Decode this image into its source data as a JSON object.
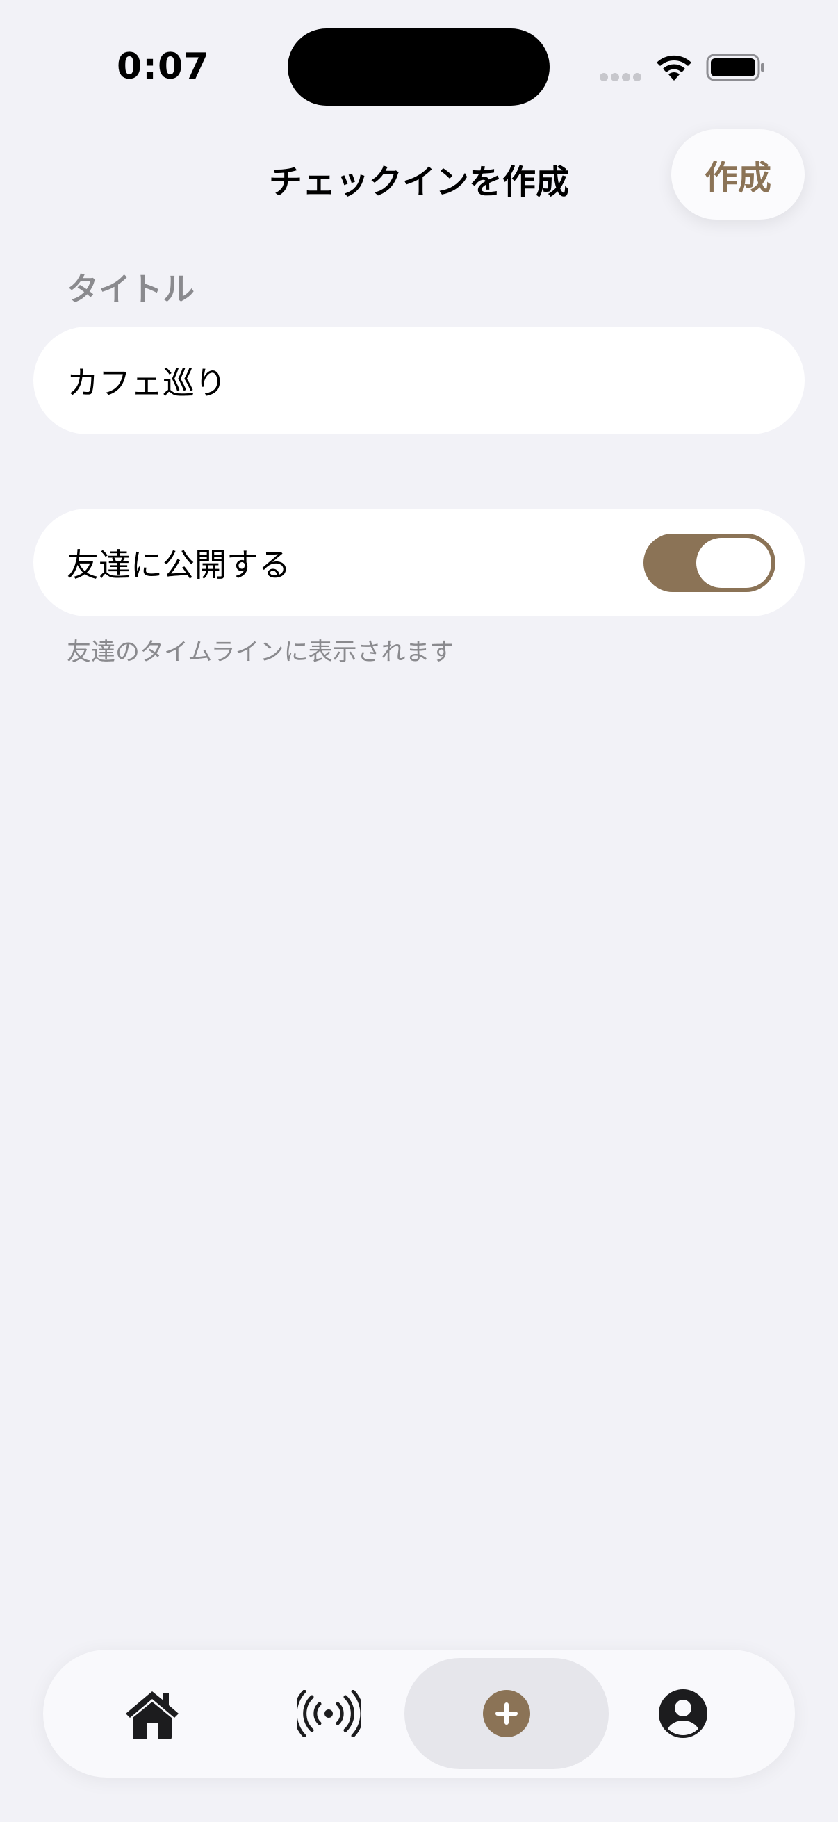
{
  "status_bar": {
    "time": "0:07"
  },
  "nav": {
    "title": "チェックインを作成",
    "create_label": "作成"
  },
  "form": {
    "title_section_label": "タイトル",
    "title_value": "カフェ巡り",
    "share_toggle": {
      "label": "友達に公開する",
      "on": true
    },
    "share_footnote": "友達のタイムラインに表示されます"
  },
  "tab_bar": {
    "tabs": [
      {
        "icon": "home-icon",
        "selected": false
      },
      {
        "icon": "broadcast-icon",
        "selected": false
      },
      {
        "icon": "plus-circle-icon",
        "selected": true
      },
      {
        "icon": "person-circle-icon",
        "selected": false
      }
    ]
  },
  "colors": {
    "accent": "#8b7356",
    "background": "#f2f2f7",
    "secondary_text": "#8a8a8e"
  }
}
